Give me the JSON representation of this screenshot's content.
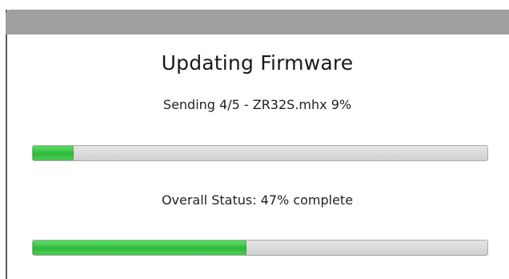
{
  "dialog": {
    "title": "Updating Firmware",
    "file_status": "Sending 4/5 - ZR32S.mhx 9%",
    "file_progress": 0.09,
    "overall_status": "Overall Status: 47% complete",
    "overall_progress": 0.47
  },
  "colors": {
    "titlebar": "#9f9f9f",
    "progress_fill": "#3fcf4a",
    "progress_track": "#d9d9d9"
  }
}
